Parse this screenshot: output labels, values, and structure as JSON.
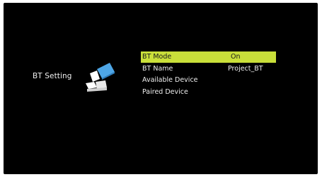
{
  "section": {
    "title": "BT Setting",
    "icon": "bluetooth-settings-icon"
  },
  "menu": {
    "items": [
      {
        "label": "BT Mode",
        "value": "On",
        "selected": true
      },
      {
        "label": "BT Name",
        "value": "Project_BT",
        "selected": false
      },
      {
        "label": "Available Device",
        "value": "",
        "selected": false
      },
      {
        "label": "Paired Device",
        "value": "",
        "selected": false
      }
    ]
  },
  "colors": {
    "background": "#000000",
    "highlight": "#c9df3a",
    "text": "#f0f0f0",
    "icon_accent": "#4ea6e6"
  }
}
